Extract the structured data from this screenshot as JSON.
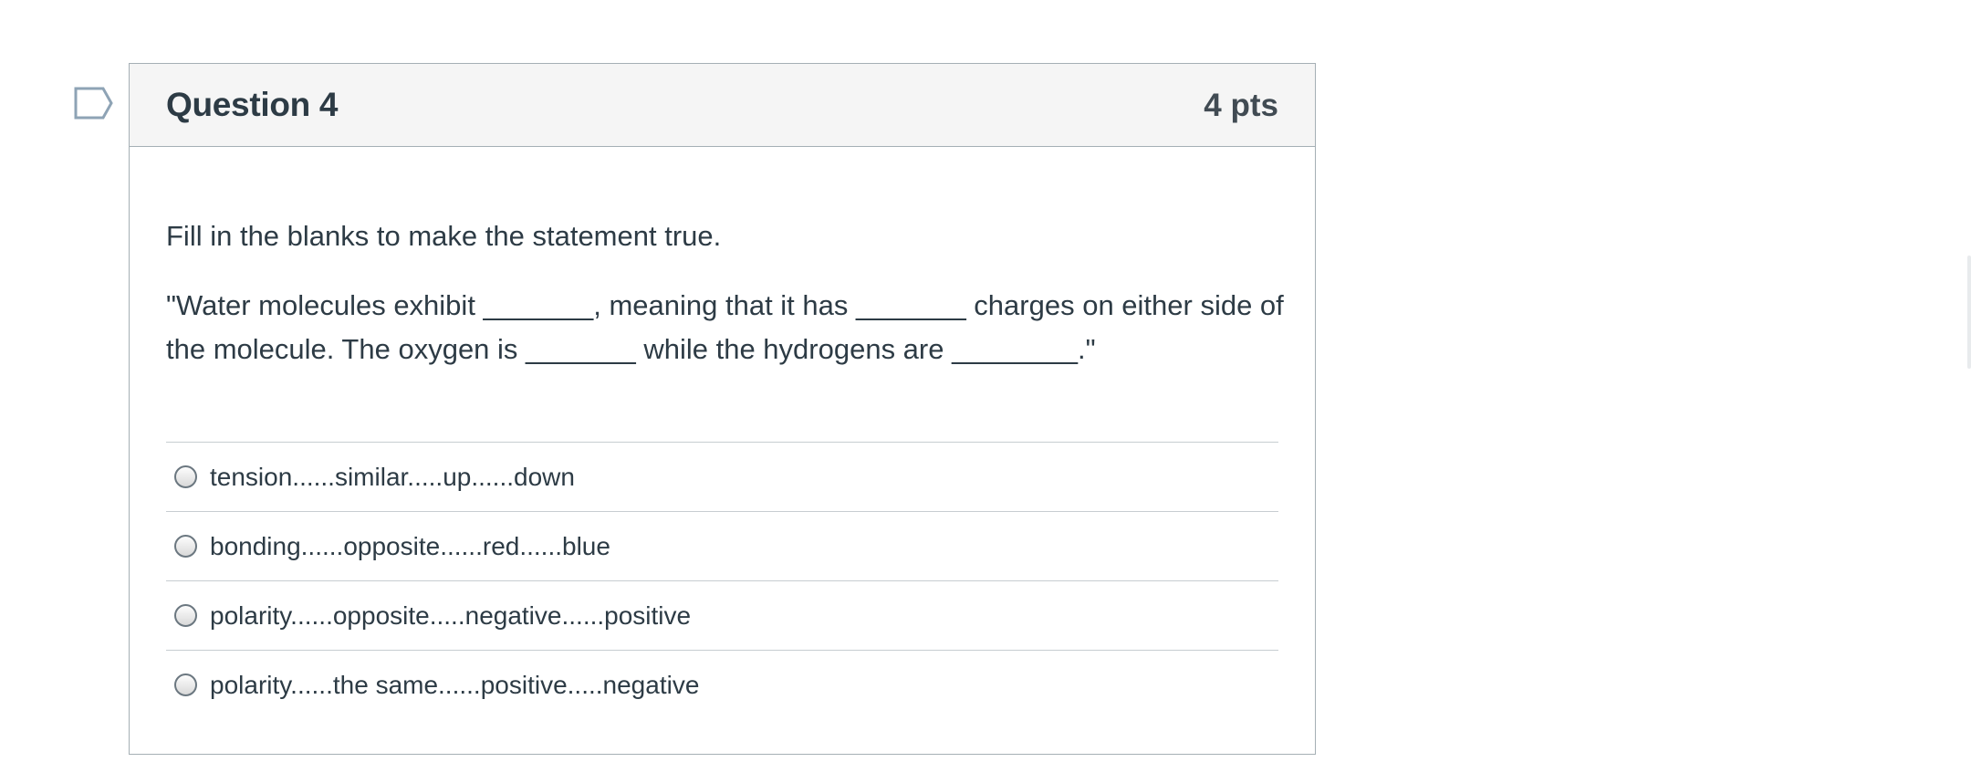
{
  "question": {
    "title": "Question 4",
    "points": "4 pts",
    "flag_icon": "flag-question-icon",
    "prompt": "Fill in the blanks to make the statement true.",
    "statement": "\"Water molecules exhibit _______, meaning that it has _______ charges on either side of the molecule. The oxygen is _______ while the hydrogens are ________.\"",
    "answers": [
      {
        "label": "tension......similar.....up......down",
        "selected": false
      },
      {
        "label": "bonding......opposite......red......blue",
        "selected": false
      },
      {
        "label": "polarity......opposite.....negative......positive",
        "selected": false
      },
      {
        "label": "polarity......the same......positive.....negative",
        "selected": false
      }
    ]
  },
  "colors": {
    "header_bg": "#f5f5f5",
    "border": "#a5afb5",
    "text": "#2d3b45",
    "flag_stroke": "#8ea3b5"
  }
}
